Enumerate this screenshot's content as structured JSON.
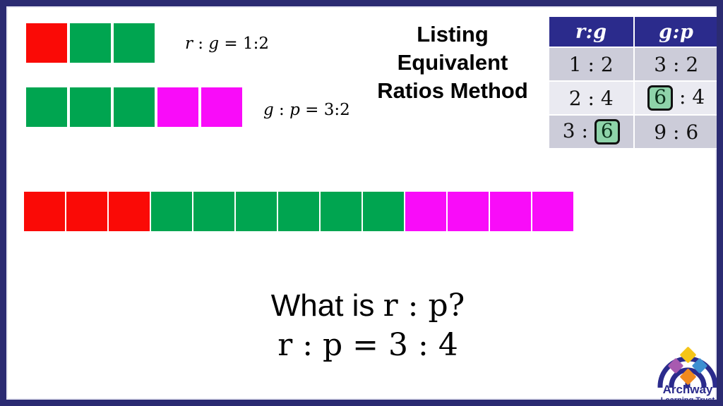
{
  "slide": {
    "title_lines": [
      "Listing",
      "Equivalent",
      "Ratios Method"
    ],
    "border_color": "#2b2b72",
    "background": "#ffffff"
  },
  "colors": {
    "red": "#fa0a06",
    "green": "#00a550",
    "magenta": "#f90cf9",
    "table_header_bg": "#2b2b8c",
    "table_row_odd": "#ccccd9",
    "table_row_even": "#eaeaf1",
    "highlight_bg": "#8ed3a9",
    "highlight_border": "#111111"
  },
  "bar_models": [
    {
      "name": "red-green-bar",
      "blocks": [
        "red",
        "green",
        "green"
      ],
      "label": {
        "left": "r",
        "sep": " : ",
        "right": "g",
        "equals": " = ",
        "value": "1:2"
      }
    },
    {
      "name": "green-pink-bar",
      "blocks": [
        "green",
        "green",
        "green",
        "magenta",
        "magenta"
      ],
      "label": {
        "left": "g",
        "sep": " : ",
        "right": "p",
        "equals": " = ",
        "value": "3:2"
      }
    },
    {
      "name": "combined-bar",
      "blocks": [
        "red",
        "red",
        "red",
        "green",
        "green",
        "green",
        "green",
        "green",
        "green",
        "magenta",
        "magenta",
        "magenta",
        "magenta"
      ],
      "label": null
    }
  ],
  "table": {
    "headers": [
      {
        "left": "r",
        "sep": ":",
        "right": "g"
      },
      {
        "left": "g",
        "sep": ":",
        "right": "p"
      }
    ],
    "rows": [
      {
        "rg": {
          "a": "1",
          "sep": " : ",
          "b": "2",
          "highlight": "none"
        },
        "gp": {
          "a": "3",
          "sep": " : ",
          "b": "2",
          "highlight": "none"
        }
      },
      {
        "rg": {
          "a": "2",
          "sep": " : ",
          "b": "4",
          "highlight": "none"
        },
        "gp": {
          "a": "6",
          "sep": " : ",
          "b": "4",
          "highlight": "a"
        }
      },
      {
        "rg": {
          "a": "3",
          "sep": " : ",
          "b": "6",
          "highlight": "b"
        },
        "gp": {
          "a": "9",
          "sep": " : ",
          "b": "6",
          "highlight": "none"
        }
      }
    ]
  },
  "question": {
    "prompt_text": "What is ",
    "prompt_math": "r : p",
    "prompt_end": "?",
    "answer": "r : p = 3 : 4"
  },
  "logo": {
    "name_top": "Archway",
    "name_bottom": "Learning Trust",
    "arch_color": "#2b2b8c",
    "diamonds": [
      "#f5c518",
      "#3d8fd1",
      "#f08a1e",
      "#a85ab0"
    ]
  }
}
